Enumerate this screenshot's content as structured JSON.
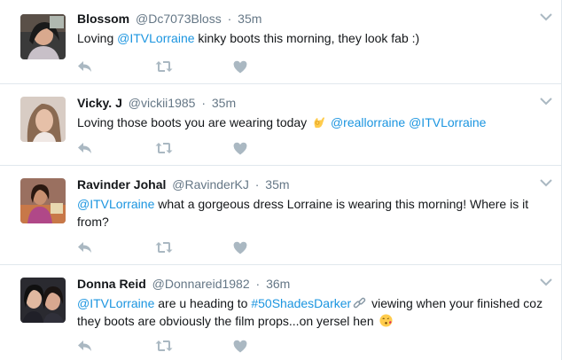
{
  "tweets": [
    {
      "name": "Blossom",
      "handle": "@Dc7073Bloss",
      "separator": "·",
      "time": "35m",
      "text_parts": [
        "Loving ",
        "@ITVLorraine",
        " kinky boots this morning, they look fab :)"
      ]
    },
    {
      "name": "Vicky. J",
      "handle": "@vickii1985",
      "separator": "·",
      "time": "35m",
      "text_parts": [
        "Loving those boots you are wearing today ",
        "",
        " ",
        "@reallorraine",
        " ",
        "@ITVLorraine"
      ]
    },
    {
      "name": "Ravinder Johal",
      "handle": "@RavinderKJ",
      "separator": "·",
      "time": "35m",
      "text_parts": [
        "@ITVLorraine",
        " what a gorgeous dress Lorraine is wearing this morning! Where is it from?"
      ]
    },
    {
      "name": "Donna Reid",
      "handle": "@Donnareid1982",
      "separator": "·",
      "time": "36m",
      "text_parts": [
        "@ITVLorraine",
        " are u heading to ",
        "#50ShadesDarker",
        " viewing when your finished coz they boots are obviously the film props...on yersel hen "
      ]
    }
  ],
  "icons": {
    "reply": "reply-icon",
    "retweet": "retweet-icon",
    "like": "heart-icon",
    "caret": "chevron-down-icon",
    "ok_hand": "ok-hand-emoji-icon",
    "chain": "chain-emoji-icon",
    "kiss": "kissing-face-emoji-icon"
  },
  "colors": {
    "link": "#1b95e0",
    "muted": "#657786",
    "icon": "#aab8c2",
    "divider": "#e1e8ed"
  }
}
